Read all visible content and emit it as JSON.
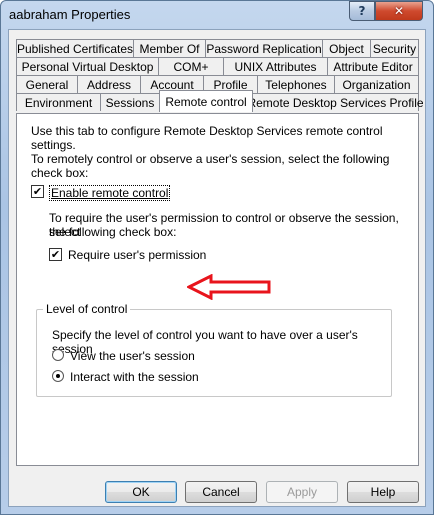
{
  "window": {
    "title": "aabraham Properties",
    "help_glyph": "?",
    "close_glyph": "✕"
  },
  "tabs": {
    "row1": [
      "Published Certificates",
      "Member Of",
      "Password Replication",
      "Object",
      "Security"
    ],
    "row2": [
      "Personal Virtual Desktop",
      "COM+",
      "UNIX Attributes",
      "Attribute Editor"
    ],
    "row3": [
      "General",
      "Address",
      "Account",
      "Profile",
      "Telephones",
      "Organization"
    ],
    "row4": [
      "Environment",
      "Sessions",
      "Remote control",
      "Remote Desktop Services Profile"
    ],
    "active": "Remote control"
  },
  "panel": {
    "intro": "Use this tab to configure Remote Desktop Services remote control settings.",
    "instruction_line1": "To remotely control or observe a user's session, select the following",
    "instruction_line2": "check box:",
    "enable_label": "Enable remote control",
    "enable_checked": true,
    "require_intro_line1": "To require the user's permission to control or observe the session, select",
    "require_intro_line2": "the following check box:",
    "require_label": "Require user's permission",
    "require_checked": true,
    "check_glyph": "✔",
    "level_group_title": "Level of control",
    "level_description": "Specify the level of control you want to have over a user's session",
    "options": [
      {
        "label": "View the user's session",
        "selected": false
      },
      {
        "label": "Interact with the session",
        "selected": true
      }
    ],
    "annotation_arrow_color": "#e8141c"
  },
  "buttons": {
    "ok": "OK",
    "cancel": "Cancel",
    "apply": "Apply",
    "help": "Help"
  }
}
